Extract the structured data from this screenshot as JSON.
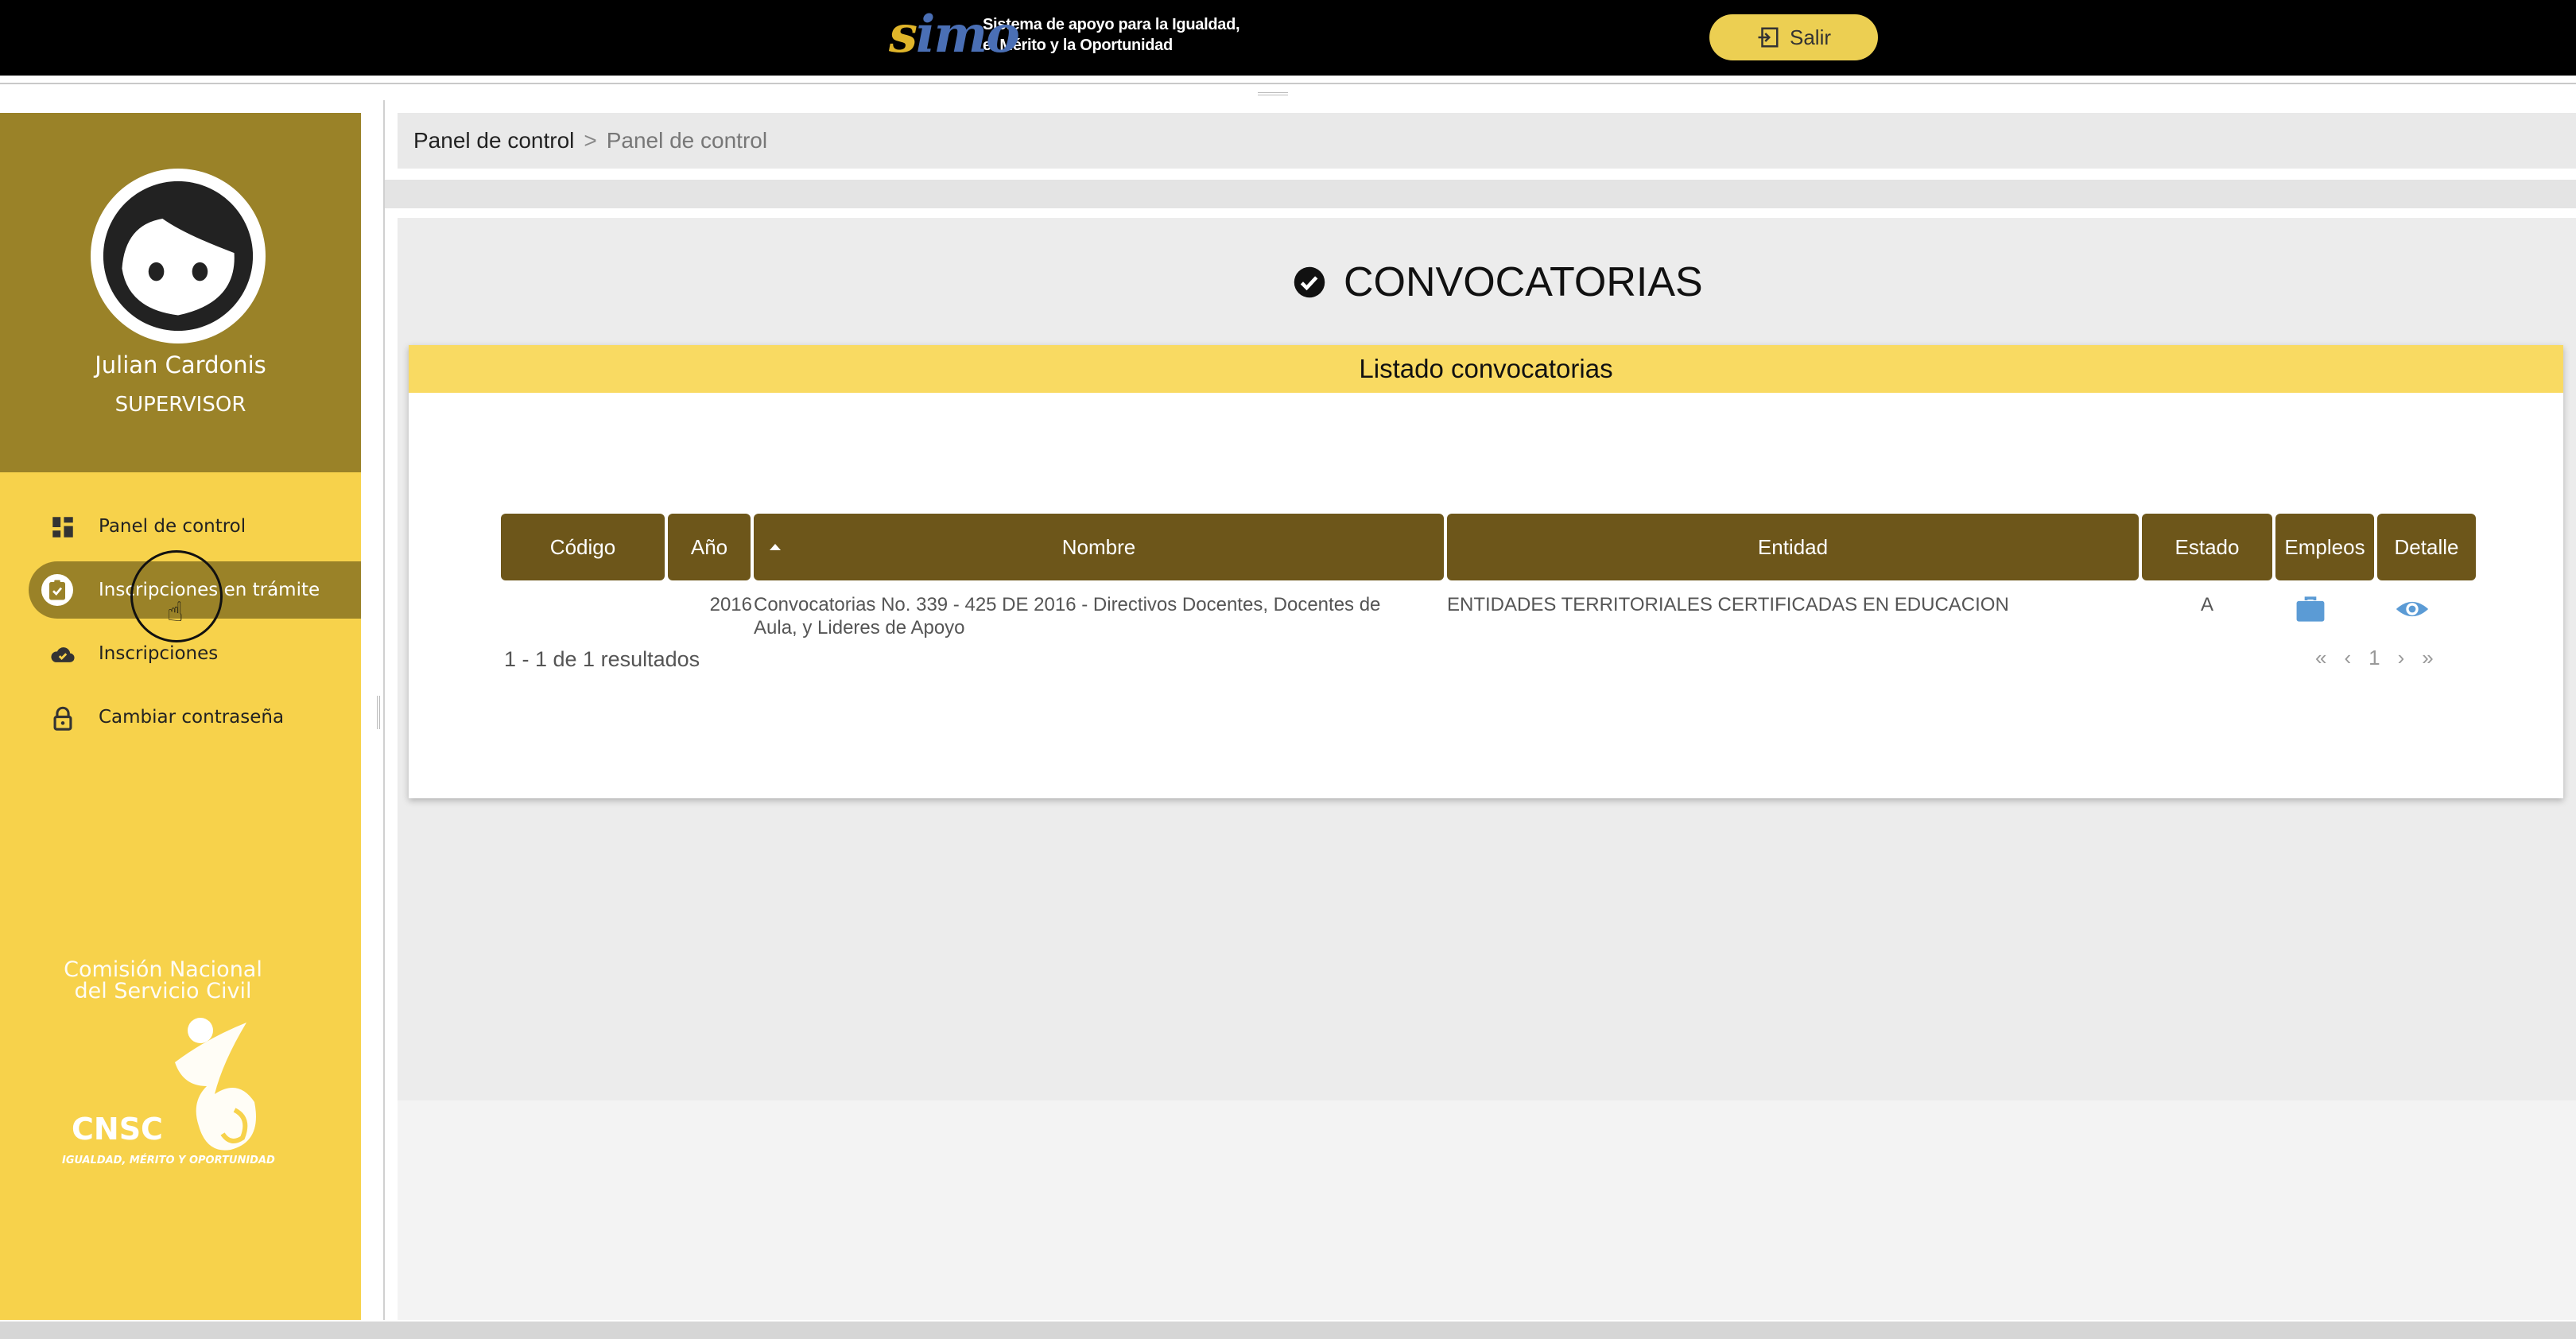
{
  "header": {
    "logo_mark": "simo",
    "logo_line1": "Sistema de apoyo para la Igualdad,",
    "logo_line2": "el Mérito y la Oportunidad",
    "logout_label": "Salir"
  },
  "user": {
    "name": "Julian Cardonis",
    "role": "SUPERVISOR"
  },
  "sidebar": {
    "items": [
      {
        "label": "Panel de control",
        "icon": "dashboard-icon",
        "active": false
      },
      {
        "label": "Inscripciones en trámite",
        "icon": "clipboard-check-icon",
        "active": true
      },
      {
        "label": "Inscripciones",
        "icon": "cloud-check-icon",
        "active": false
      },
      {
        "label": "Cambiar contraseña",
        "icon": "lock-icon",
        "active": false
      }
    ],
    "org_line1": "Comisión Nacional",
    "org_line2": "del Servicio Civil",
    "org_acronym": "CNSC",
    "org_tagline": "IGUALDAD, MÉRITO Y OPORTUNIDAD"
  },
  "breadcrumb": {
    "root": "Panel de control",
    "separator": ">",
    "current": "Panel de control"
  },
  "page": {
    "title": "CONVOCATORIAS",
    "title_icon": "check-circle-icon"
  },
  "listing": {
    "title": "Listado convocatorias",
    "columns": [
      "Código",
      "Año",
      "Nombre",
      "Entidad",
      "Estado",
      "Empleos",
      "Detalle"
    ],
    "sorted_column": "Nombre",
    "rows": [
      {
        "codigo": "",
        "anio": "2016",
        "nombre_line1": "Convocatorias No. 339 - 425 DE 2016 - Directivos Docentes, Docentes de",
        "nombre_line2": "Aula, y Lideres de Apoyo",
        "entidad": "ENTIDADES TERRITORIALES CERTIFICADAS EN EDUCACION",
        "estado": "A",
        "empleos_icon": "briefcase-icon",
        "detalle_icon": "eye-icon"
      }
    ],
    "results_text": "1 - 1 de 1 resultados",
    "pager": {
      "first": "«",
      "prev": "‹",
      "page": "1",
      "next": "›",
      "last": "»"
    }
  },
  "colors": {
    "topbar": "#000000",
    "accent_yellow": "#f7d24b",
    "accent_olive": "#9a8228",
    "table_header": "#6d561a",
    "icon_blue": "#5b9bd5"
  }
}
